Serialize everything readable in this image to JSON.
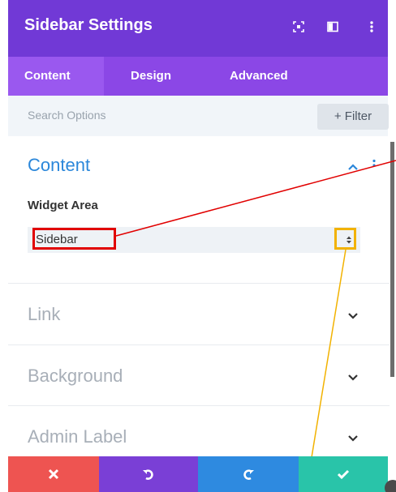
{
  "header": {
    "title": "Sidebar Settings",
    "icons": [
      "expand-icon",
      "split-view-icon",
      "more-vertical-icon"
    ],
    "color": "#7139d6"
  },
  "tabs": [
    {
      "label": "Content",
      "active": true
    },
    {
      "label": "Design",
      "active": false
    },
    {
      "label": "Advanced",
      "active": false
    }
  ],
  "search": {
    "placeholder": "Search Options",
    "filter_label": "+ Filter"
  },
  "sections": {
    "content": {
      "title": "Content",
      "expanded": true,
      "field_label": "Widget Area",
      "select_value": "Sidebar"
    },
    "link": {
      "title": "Link",
      "expanded": false
    },
    "background": {
      "title": "Background",
      "expanded": false
    },
    "admin_label": {
      "title": "Admin Label",
      "expanded": false
    }
  },
  "footer": {
    "buttons": [
      {
        "name": "discard-button",
        "icon": "close-icon",
        "color": "#ee5451"
      },
      {
        "name": "undo-button",
        "icon": "undo-icon",
        "color": "#7a3fd6"
      },
      {
        "name": "redo-button",
        "icon": "redo-icon",
        "color": "#2e8ae0"
      },
      {
        "name": "save-button",
        "icon": "check-icon",
        "color": "#29c4a9"
      }
    ]
  },
  "annotations": {
    "red_color": "#e10000",
    "yellow_color": "#f2b200"
  }
}
